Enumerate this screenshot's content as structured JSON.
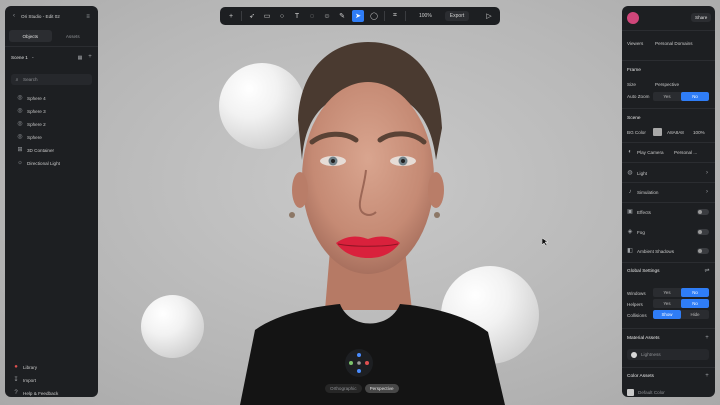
{
  "app": {
    "title": "Ori Studio - Edit 02"
  },
  "left_panel": {
    "tabs": [
      "Objects",
      "Assets"
    ],
    "scene": "Scene 1",
    "search_placeholder": "Search",
    "objects": [
      "Sphere 4",
      "Sphere 3",
      "Sphere 2",
      "Sphere",
      "3D Container",
      "Directional Light"
    ],
    "footer": [
      "Library",
      "Import",
      "Help & Feedback"
    ]
  },
  "toolbar": {
    "zoom": "100%",
    "export": "Export"
  },
  "viewport": {
    "view_tabs": [
      "Orthographic",
      "Perspective"
    ],
    "active_view": "Perspective"
  },
  "right_panel": {
    "share": "Share",
    "viewers_label": "Viewers",
    "viewers_value": "Personal Domains",
    "frame_head": "Frame",
    "size_label": "Size",
    "size_value": "Perspective",
    "auto_zoom_label": "Auto Zoom",
    "yes": "Yes",
    "no": "No",
    "scene_head": "Scene",
    "bg_color_label": "BG Color",
    "bg_color_value": "A8A8A8",
    "bg_opacity": "100%",
    "play_camera_label": "Play Camera",
    "play_camera_value": "Personal ...",
    "light_label": "Light",
    "simulation_label": "Simulation",
    "effects_label": "Effects",
    "fog_label": "Fog",
    "ambient_label": "Ambient Shadows",
    "global_head": "Global Settings",
    "windows_label": "Windows",
    "helpers_label": "Helpers",
    "collisions_label": "Collisions",
    "collisions_on": "Show",
    "collisions_off": "Hide",
    "material_head": "Material Assets",
    "material_item": "Lightness",
    "color_head": "Color Assets",
    "color_item": "Default Color"
  },
  "colors": {
    "accent": "#2f7df6",
    "panel": "#1d1f22",
    "lips": "#d9213c"
  }
}
